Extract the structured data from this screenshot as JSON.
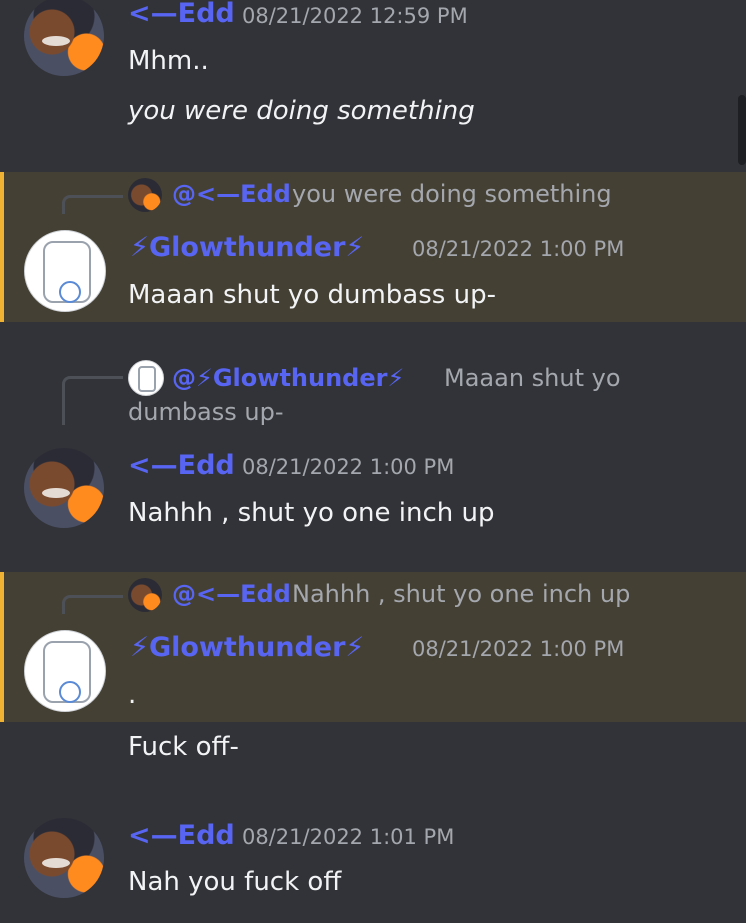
{
  "messages": [
    {
      "author": "<—Edd",
      "timestamp": "08/21/2022 12:59 PM",
      "lines": [
        "Mhm..",
        "you were doing something"
      ]
    },
    {
      "author": "⚡Glowthunder⚡",
      "timestamp": "08/21/2022 1:00 PM",
      "reply": {
        "mention": "@<—Edd",
        "text": "you were doing something"
      },
      "lines": [
        "Maaan shut yo dumbass up-"
      ]
    },
    {
      "author": "<—Edd",
      "timestamp": "08/21/2022 1:00 PM",
      "reply": {
        "mention": "@⚡Glowthunder⚡",
        "text_line1": "Maaan shut yo",
        "text_line2": "dumbass up-"
      },
      "lines": [
        "Nahhh , shut yo one inch up"
      ]
    },
    {
      "author": "⚡Glowthunder⚡",
      "timestamp": "08/21/2022 1:00 PM",
      "reply": {
        "mention": "@<—Edd",
        "text": "Nahhh , shut yo one inch up"
      },
      "lines": [
        ".",
        "Fuck off-"
      ]
    },
    {
      "author": "<—Edd",
      "timestamp": "08/21/2022 1:01 PM",
      "lines": [
        "Nah you fuck off"
      ]
    }
  ],
  "colors": {
    "background": "#313338",
    "highlight": "#444034",
    "highlight_bar": "#f0b232",
    "username": "#5865f2",
    "timestamp": "#a4a7ad"
  }
}
